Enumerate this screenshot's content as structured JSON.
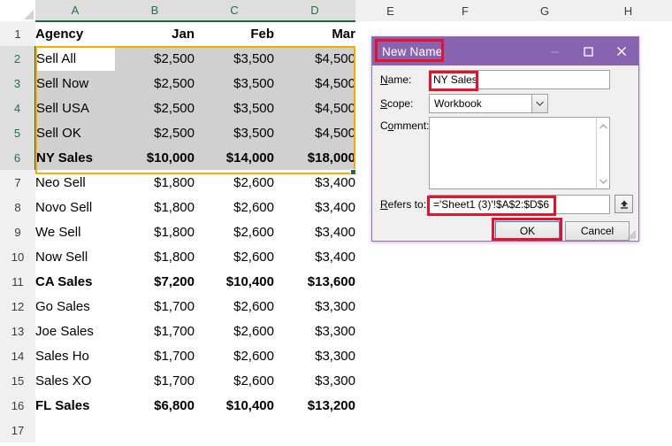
{
  "spreadsheet": {
    "column_headers": [
      "A",
      "B",
      "C",
      "D",
      "E",
      "F",
      "G",
      "H"
    ],
    "selected_columns": [
      "A",
      "B",
      "C",
      "D"
    ],
    "row_numbers": [
      "1",
      "2",
      "3",
      "4",
      "5",
      "6",
      "7",
      "8",
      "9",
      "10",
      "11",
      "12",
      "13",
      "14",
      "15",
      "16",
      "17"
    ],
    "selected_rows": [
      "2",
      "3",
      "4",
      "5",
      "6"
    ],
    "active_cell": "A2",
    "selection_range": "A2:D6",
    "selection_border_color": "#ffa800",
    "selection_fill_color": "#d0d0d0",
    "header_accent_color": "#217346",
    "rows": [
      {
        "r": "1",
        "bold": true,
        "cells": [
          "Agency",
          "Jan",
          "Feb",
          "Mar"
        ]
      },
      {
        "r": "2",
        "bold": false,
        "cells": [
          "Sell All",
          "$2,500",
          "$3,500",
          "$4,500"
        ]
      },
      {
        "r": "3",
        "bold": false,
        "cells": [
          "Sell Now",
          "$2,500",
          "$3,500",
          "$4,500"
        ]
      },
      {
        "r": "4",
        "bold": false,
        "cells": [
          "Sell USA",
          "$2,500",
          "$3,500",
          "$4,500"
        ]
      },
      {
        "r": "5",
        "bold": false,
        "cells": [
          "Sell OK",
          "$2,500",
          "$3,500",
          "$4,500"
        ]
      },
      {
        "r": "6",
        "bold": true,
        "cells": [
          "NY Sales",
          "$10,000",
          "$14,000",
          "$18,000"
        ]
      },
      {
        "r": "7",
        "bold": false,
        "cells": [
          "Neo Sell",
          "$1,800",
          "$2,600",
          "$3,400"
        ]
      },
      {
        "r": "8",
        "bold": false,
        "cells": [
          "Novo Sell",
          "$1,800",
          "$2,600",
          "$3,400"
        ]
      },
      {
        "r": "9",
        "bold": false,
        "cells": [
          "We Sell",
          "$1,800",
          "$2,600",
          "$3,400"
        ]
      },
      {
        "r": "10",
        "bold": false,
        "cells": [
          "Now Sell",
          "$1,800",
          "$2,600",
          "$3,400"
        ]
      },
      {
        "r": "11",
        "bold": true,
        "cells": [
          "CA Sales",
          "$7,200",
          "$10,400",
          "$13,600"
        ]
      },
      {
        "r": "12",
        "bold": false,
        "cells": [
          "Go Sales",
          "$1,700",
          "$2,600",
          "$3,300"
        ]
      },
      {
        "r": "13",
        "bold": false,
        "cells": [
          "Joe Sales",
          "$1,700",
          "$2,600",
          "$3,300"
        ]
      },
      {
        "r": "14",
        "bold": false,
        "cells": [
          "Sales Ho",
          "$1,700",
          "$2,600",
          "$3,300"
        ]
      },
      {
        "r": "15",
        "bold": false,
        "cells": [
          "Sales XO",
          "$1,700",
          "$2,600",
          "$3,300"
        ]
      },
      {
        "r": "16",
        "bold": true,
        "cells": [
          "FL Sales",
          "$6,800",
          "$10,400",
          "$13,200"
        ]
      },
      {
        "r": "17",
        "bold": false,
        "cells": [
          "",
          "",
          "",
          ""
        ]
      }
    ]
  },
  "dialog": {
    "title": "New Name",
    "title_bar_color": "#8864b0",
    "window_buttons": {
      "minimize": "minimize-icon",
      "maximize": "maximize-icon",
      "close": "close-icon"
    },
    "fields": {
      "name_label": "Name:",
      "name_value": "NY Sales",
      "scope_label": "Scope:",
      "scope_value": "Workbook",
      "scope_options": [
        "Workbook"
      ],
      "comment_label": "Comment:",
      "comment_value": "",
      "refers_to_label": "Refers to:",
      "refers_to_value": "='Sheet1 (3)'!$A$2:$D$6"
    },
    "buttons": {
      "ok": "OK",
      "cancel": "Cancel"
    },
    "annotation_color": "#e8102b"
  }
}
